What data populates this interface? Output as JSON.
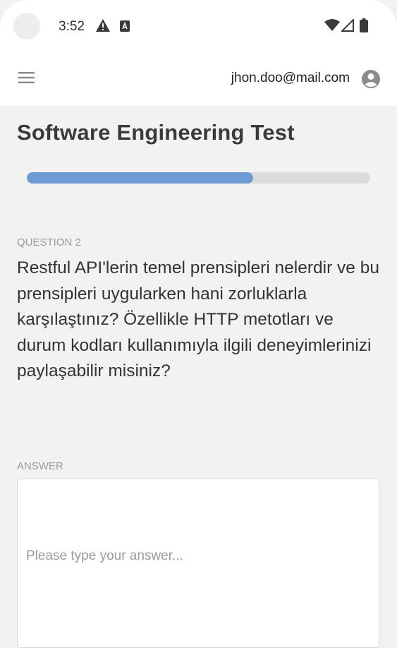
{
  "status_bar": {
    "time": "3:52",
    "icons": [
      "warning-icon",
      "a-notification-icon",
      "wifi-icon",
      "signal-icon",
      "battery-icon"
    ]
  },
  "app_bar": {
    "menu_icon": "hamburger-menu-icon",
    "user_email": "jhon.doo@mail.com",
    "account_icon": "account-circle-icon"
  },
  "test": {
    "title": "Software Engineering Test",
    "progress": 0.66,
    "progress_color": "#6f9bd4",
    "question_label": "QUESTION 2",
    "question_text": "Restful API'lerin temel prensipleri nelerdir ve bu prensipleri uygularken hani zorluklarla karşılaştınız? Özellikle HTTP metotları ve durum kodları kullanımıyla ilgili deneyimlerinizi paylaşabilir misiniz?",
    "answer_label": "ANSWER",
    "answer_placeholder": "Please type your answer...",
    "answer_value": ""
  }
}
